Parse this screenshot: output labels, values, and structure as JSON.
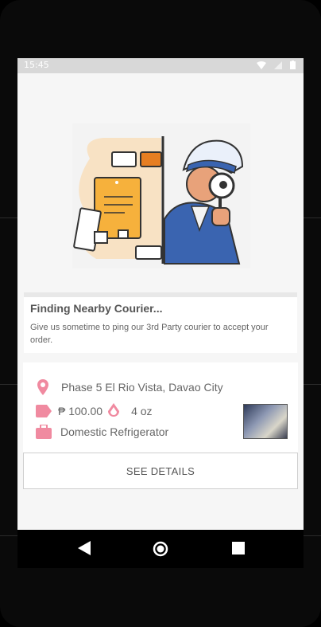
{
  "status_bar": {
    "time": "15:45",
    "icons": [
      "wifi-icon",
      "signal-icon",
      "battery-icon"
    ]
  },
  "searching": {
    "title": "Finding Nearby Courier...",
    "message": "Give us sometime to ping our 3rd Party courier to accept your order."
  },
  "order": {
    "address": "Phase 5 El Rio Vista, Davao City",
    "price": "₱ 100.00",
    "weight": "4 oz",
    "item": "Domestic Refrigerator",
    "details_button": "SEE DETAILS"
  },
  "colors": {
    "accent": "#f08aa0",
    "screen_bg": "#f6f6f6",
    "text": "#666666"
  }
}
